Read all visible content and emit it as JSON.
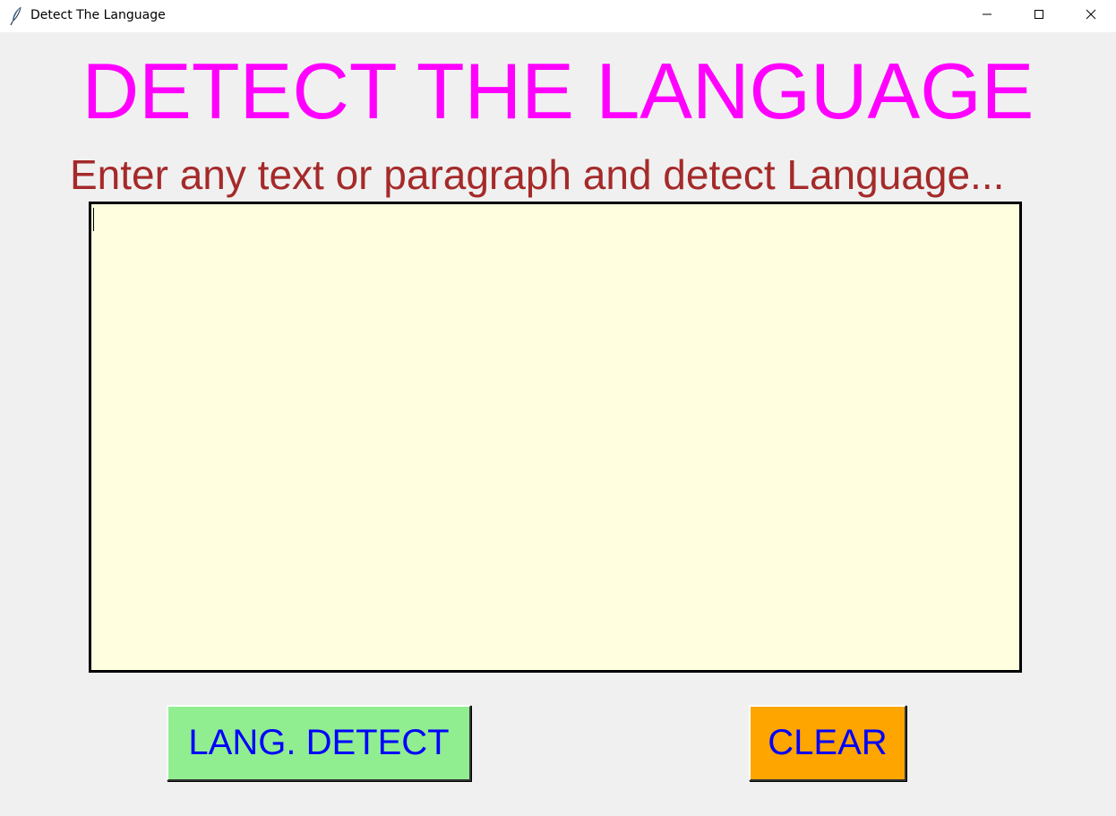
{
  "window": {
    "title": "Detect The Language",
    "icon": "feather-icon",
    "controls": {
      "minimize": "minimize-icon",
      "maximize": "maximize-icon",
      "close": "close-icon"
    }
  },
  "main": {
    "heading": "DETECT THE LANGUAGE",
    "subheading": "Enter any text or paragraph and detect Language...",
    "text_input": {
      "value": "",
      "placeholder": ""
    },
    "buttons": {
      "detect_label": "LANG. DETECT",
      "clear_label": "CLEAR"
    }
  },
  "colors": {
    "heading": "#ff00ff",
    "subheading": "#a52a2a",
    "text_area_bg": "#ffffe0",
    "detect_button_bg": "#90ee90",
    "clear_button_bg": "#ffa500",
    "button_text": "#0000ff",
    "window_bg": "#f0f0f0"
  }
}
